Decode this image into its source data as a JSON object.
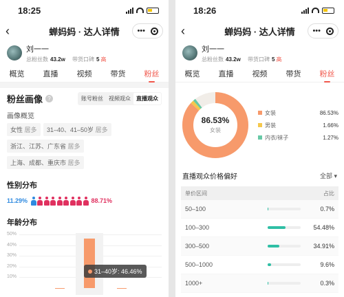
{
  "left": {
    "status": {
      "time": "18:25"
    },
    "nav": {
      "title": "蝉妈妈 · 达人详情",
      "more": "•••"
    },
    "profile": {
      "name": "刘一一",
      "fans_label": "总粉丝数",
      "fans_value": "43.2w",
      "rep_label": "带货口碑",
      "rep_value": "5",
      "rep_level": "高"
    },
    "tabs": [
      "概览",
      "直播",
      "视频",
      "带货",
      "粉丝"
    ],
    "section": {
      "title": "粉丝画像",
      "help": "?",
      "segments": [
        "账号粉丝",
        "视频观众",
        "直播观众"
      ]
    },
    "overview_label": "画像概览",
    "chips": [
      {
        "text": "女性",
        "suffix": "居多"
      },
      {
        "text": "31–40、41–50岁",
        "suffix": "居多"
      },
      {
        "text": "浙江、江苏、广东省",
        "suffix": "居多"
      },
      {
        "text": "上海、成都、重庆市",
        "suffix": "居多"
      }
    ],
    "gender": {
      "title": "性别分布",
      "male": "11.29%",
      "female": "88.71%",
      "male_count": 1,
      "female_count": 8
    },
    "age": {
      "title": "年龄分布",
      "tooltip": "31–40岁: 46.46%"
    }
  },
  "right": {
    "status": {
      "time": "18:26"
    },
    "nav": {
      "title": "蝉妈妈 · 达人详情",
      "more": "•••"
    },
    "profile": {
      "name": "刘一一",
      "fans_label": "总粉丝数",
      "fans_value": "43.2w",
      "rep_label": "带货口碑",
      "rep_value": "5",
      "rep_level": "高"
    },
    "tabs": [
      "概览",
      "直播",
      "视频",
      "带货",
      "粉丝"
    ],
    "donut": {
      "center_value": "86.53%",
      "center_label": "女装"
    },
    "legend": [
      {
        "name": "女装",
        "value": "86.53%",
        "color": "#f79a6b"
      },
      {
        "name": "男装",
        "value": "1.66%",
        "color": "#f5c84c"
      },
      {
        "name": "内衣/袜子",
        "value": "1.27%",
        "color": "#67c9a6"
      }
    ],
    "price": {
      "title": "直播观众价格偏好",
      "filter": "全部",
      "col_range": "单价区间",
      "col_share": "占比",
      "rows": [
        {
          "range": "50–100",
          "pct": "0.7%"
        },
        {
          "range": "100–300",
          "pct": "54.48%"
        },
        {
          "range": "300–500",
          "pct": "34.91%"
        },
        {
          "range": "500–1000",
          "pct": "9.6%"
        },
        {
          "range": "1000+",
          "pct": "0.3%"
        }
      ]
    }
  },
  "chart_data": [
    {
      "type": "pie",
      "categories": [
        "女装",
        "男装",
        "内衣/袜子"
      ],
      "values": [
        86.53,
        1.66,
        1.27
      ]
    },
    {
      "type": "bar",
      "title": "年龄分布",
      "categories": [
        "31–40岁"
      ],
      "values": [
        46.46
      ],
      "ylim": [
        0,
        50
      ],
      "yticks": [
        "50%",
        "40%",
        "30%",
        "20%",
        "10%"
      ]
    }
  ]
}
